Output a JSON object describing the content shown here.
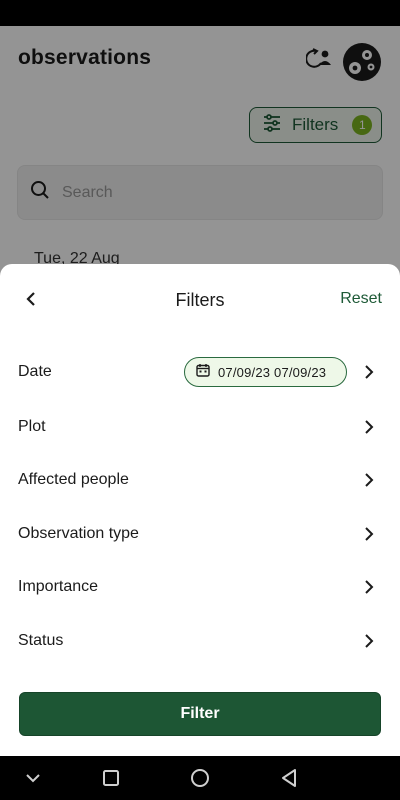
{
  "app": {
    "title": "observations",
    "filters_button": {
      "label": "Filters",
      "count": "1"
    },
    "search": {
      "placeholder": "Search"
    },
    "first_date_header": "Tue, 22 Aug"
  },
  "sheet": {
    "title": "Filters",
    "reset_label": "Reset",
    "rows": [
      {
        "label": "Date",
        "value": "07/09/23 07/09/23"
      },
      {
        "label": "Plot"
      },
      {
        "label": "Affected people"
      },
      {
        "label": "Observation type"
      },
      {
        "label": "Importance"
      },
      {
        "label": "Status"
      }
    ],
    "filter_button_label": "Filter"
  },
  "colors": {
    "primary_green": "#1d5634",
    "badge_green": "#7bb31f",
    "chip_background": "#eef8e8",
    "scrim": "rgba(0,0,0,0.42)"
  },
  "icons": {
    "sync": "sync-person-icon",
    "avatar": "gears-icon",
    "filters": "sliders-icon",
    "search": "search-icon",
    "back": "chevron-left-icon",
    "calendar": "calendar-icon",
    "row_arrow": "chevron-right-icon",
    "nav": [
      "chevron-down-icon",
      "square-icon",
      "circle-icon",
      "triangle-back-icon"
    ]
  }
}
